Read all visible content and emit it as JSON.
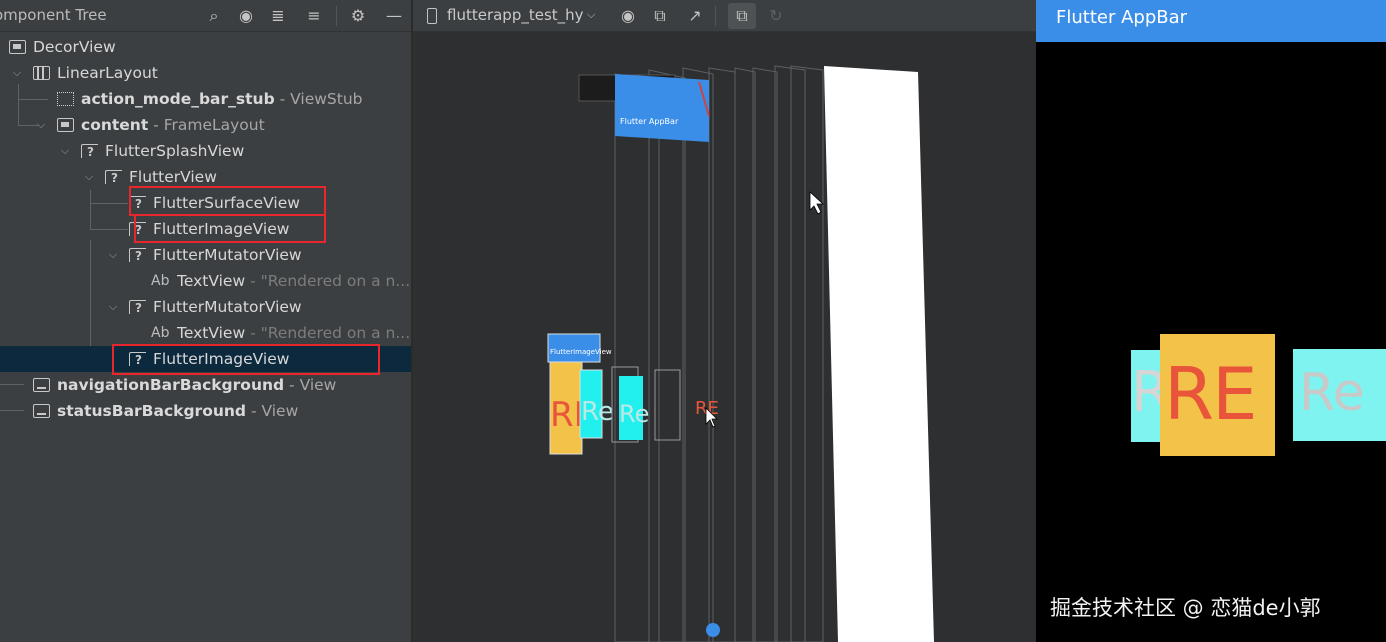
{
  "tree_panel": {
    "title": "omponent Tree",
    "toolbar_icons": [
      "search-icon",
      "eye-icon",
      "expand-all-icon",
      "collapse-all-icon",
      "gear-icon",
      "minimize-icon"
    ],
    "nodes": [
      {
        "name": "DecorView",
        "type": "",
        "text": "",
        "icon": "frame-icon",
        "expanded": null,
        "selected": false
      },
      {
        "name": "LinearLayout",
        "type": "",
        "text": "",
        "icon": "linear-layout-icon",
        "expanded": true,
        "selected": false
      },
      {
        "name": "action_mode_bar_stub",
        "type": " - ViewStub",
        "text": "",
        "icon": "viewstub-icon",
        "expanded": null,
        "selected": false
      },
      {
        "name": "content",
        "type": " - FrameLayout",
        "text": "",
        "icon": "frame-layout-icon",
        "expanded": true,
        "selected": false
      },
      {
        "name": "FlutterSplashView",
        "type": "",
        "text": "",
        "icon": "custom-view-icon",
        "expanded": true,
        "selected": false
      },
      {
        "name": "FlutterView",
        "type": "",
        "text": "",
        "icon": "custom-view-icon",
        "expanded": true,
        "selected": false
      },
      {
        "name": "FlutterSurfaceView",
        "type": "",
        "text": "",
        "icon": "custom-view-icon",
        "expanded": null,
        "selected": false
      },
      {
        "name": "FlutterImageView",
        "type": "",
        "text": "",
        "icon": "custom-view-icon",
        "expanded": null,
        "selected": false
      },
      {
        "name": "FlutterMutatorView",
        "type": "",
        "text": "",
        "icon": "custom-view-icon",
        "expanded": true,
        "selected": false
      },
      {
        "name": "TextView",
        "type": " - ",
        "text": "\"Rendered on a n...",
        "icon": "text-view-icon",
        "expanded": null,
        "selected": false
      },
      {
        "name": "FlutterMutatorView",
        "type": "",
        "text": "",
        "icon": "custom-view-icon",
        "expanded": true,
        "selected": false
      },
      {
        "name": "TextView",
        "type": " - ",
        "text": "\"Rendered on a n...",
        "icon": "text-view-icon",
        "expanded": null,
        "selected": false
      },
      {
        "name": "FlutterImageView",
        "type": "",
        "text": "",
        "icon": "custom-view-icon",
        "expanded": null,
        "selected": true
      },
      {
        "name": "navigationBarBackground",
        "type": " - View",
        "text": "",
        "icon": "view-icon",
        "expanded": null,
        "selected": false
      },
      {
        "name": "statusBarBackground",
        "type": " - View",
        "text": "",
        "icon": "view-icon",
        "expanded": null,
        "selected": false
      }
    ]
  },
  "inspector": {
    "device": "flutterapp_test_hy",
    "toolbar_icons": [
      "phone-icon",
      "chevron-down-icon",
      "eye-icon",
      "export-snapshot-icon",
      "reset-view-icon",
      "live-updates-icon",
      "refresh-icon"
    ],
    "layer_labels": {
      "appbar": "Flutter AppBar",
      "image_view": "FlutterImageView",
      "re_big": "RE",
      "re_small": "Re",
      "re_red": "RE"
    }
  },
  "preview": {
    "appbar_title": "Flutter AppBar",
    "tiles": {
      "left": "R",
      "center": "RE",
      "right": "Re"
    },
    "watermark": "掘金技术社区 @ 恋猫de小郭",
    "colors": {
      "appbar": "#3b8ee8",
      "cyan": "#7ff3f0",
      "amber": "#f3c349",
      "red_text": "#e8553a",
      "highlight": "#e8262b",
      "selection": "#0d293e"
    }
  }
}
